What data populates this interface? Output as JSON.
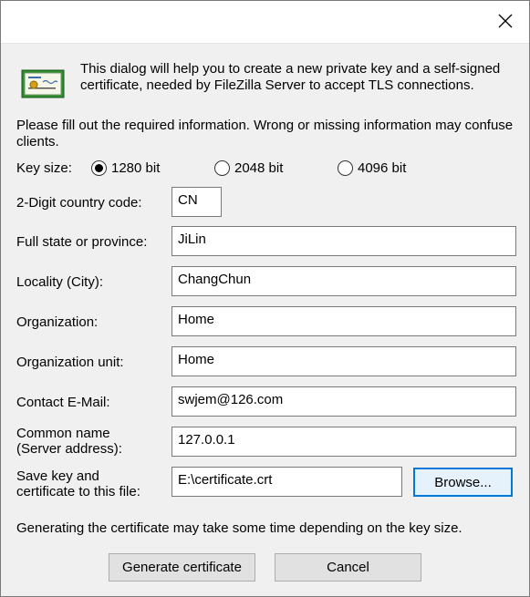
{
  "dialog": {
    "intro_text": "This dialog will help you to create a new private key and a self-signed certificate, needed by FileZilla Server to accept TLS connections.",
    "fill_text": "Please fill out the required information. Wrong or missing information may confuse clients."
  },
  "key_size": {
    "label": "Key size:",
    "options": [
      {
        "label": "1280 bit",
        "checked": true
      },
      {
        "label": "2048 bit",
        "checked": false
      },
      {
        "label": "4096 bit",
        "checked": false
      }
    ]
  },
  "fields": {
    "country": {
      "label": "2-Digit country code:",
      "value": "CN"
    },
    "state": {
      "label": "Full state or province:",
      "value": "JiLin"
    },
    "locality": {
      "label": "Locality (City):",
      "value": "ChangChun"
    },
    "organization": {
      "label": "Organization:",
      "value": "Home"
    },
    "org_unit": {
      "label": "Organization unit:",
      "value": "Home"
    },
    "email": {
      "label": "Contact E-Mail:",
      "value": "swjem@126.com"
    },
    "common_name": {
      "label_line1": "Common name",
      "label_line2": "(Server address):",
      "value": "127.0.0.1"
    },
    "save_file": {
      "label_line1": "Save key and",
      "label_line2": "certificate to this file:",
      "value": "E:\\certificate.crt"
    }
  },
  "buttons": {
    "browse": "Browse...",
    "generate": "Generate certificate",
    "cancel": "Cancel"
  },
  "note_text": "Generating the certificate may take some time depending on the key size.",
  "colors": {
    "dialog_bg": "#f0f0f0",
    "focus_border": "#0078d7",
    "icon_green": "#2e8b2e"
  },
  "icons": {
    "close": "close-icon",
    "certificate": "certificate-icon"
  }
}
